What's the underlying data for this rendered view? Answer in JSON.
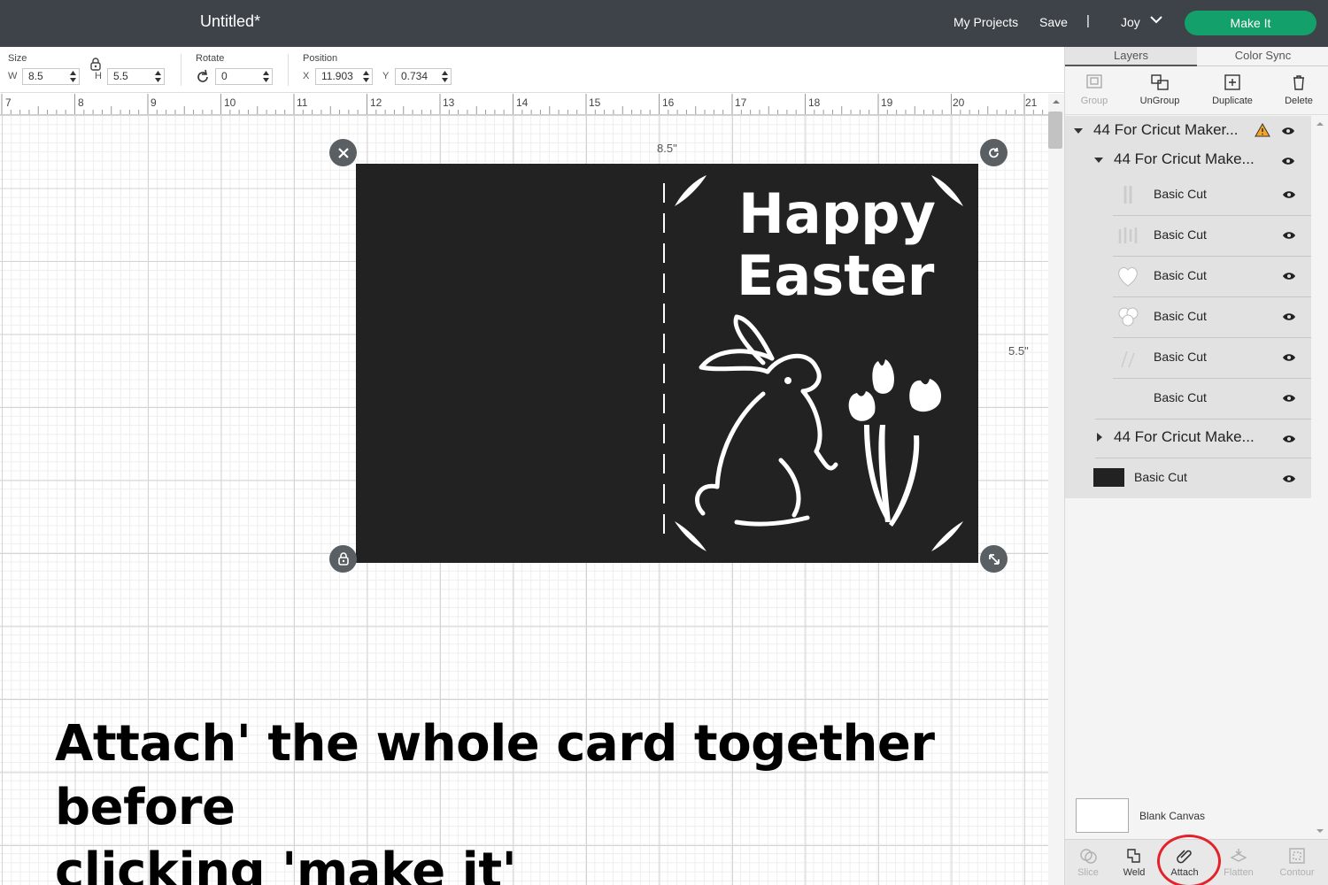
{
  "topbar": {
    "title": "Untitled*",
    "my_projects": "My Projects",
    "save": "Save",
    "separator": "|",
    "user": "Joy",
    "make_it": "Make It",
    "make_it_color": "#14a06a"
  },
  "editbar": {
    "size_label": "Size",
    "w_label": "W",
    "w_value": "8.5",
    "h_label": "H",
    "h_value": "5.5",
    "rotate_label": "Rotate",
    "rotate_value": "0",
    "position_label": "Position",
    "x_label": "X",
    "x_value": "11.903",
    "y_label": "Y",
    "y_value": "0.734"
  },
  "ruler": [
    "7",
    "8",
    "9",
    "10",
    "11",
    "12",
    "13",
    "14",
    "15",
    "16",
    "17",
    "18",
    "19",
    "20",
    "21"
  ],
  "canvas": {
    "width_label": "8.5\"",
    "height_label": "5.5\"",
    "card_line1": "Happy",
    "card_line2": "Easter",
    "card_color": "#222222"
  },
  "caption": {
    "strong": "Attach",
    "rest_line1": "' the whole card together before",
    "line2": "clicking 'make it'"
  },
  "panel": {
    "tabs": [
      "Layers",
      "Color Sync"
    ],
    "tools": [
      "Group",
      "UnGroup",
      "Duplicate",
      "Delete"
    ],
    "layers": {
      "top_group": "44 For Cricut Maker...",
      "sub_group": "44 For Cricut Make...",
      "items": [
        "Basic Cut",
        "Basic Cut",
        "Basic Cut",
        "Basic Cut",
        "Basic Cut",
        "Basic Cut"
      ],
      "collapsed_group": "44 For Cricut Make...",
      "bottom_item": "Basic Cut"
    },
    "blank_canvas": "Blank Canvas",
    "bottom_tools": [
      "Slice",
      "Weld",
      "Attach",
      "Flatten",
      "Contour"
    ],
    "highlight_color": "#e3222b"
  }
}
